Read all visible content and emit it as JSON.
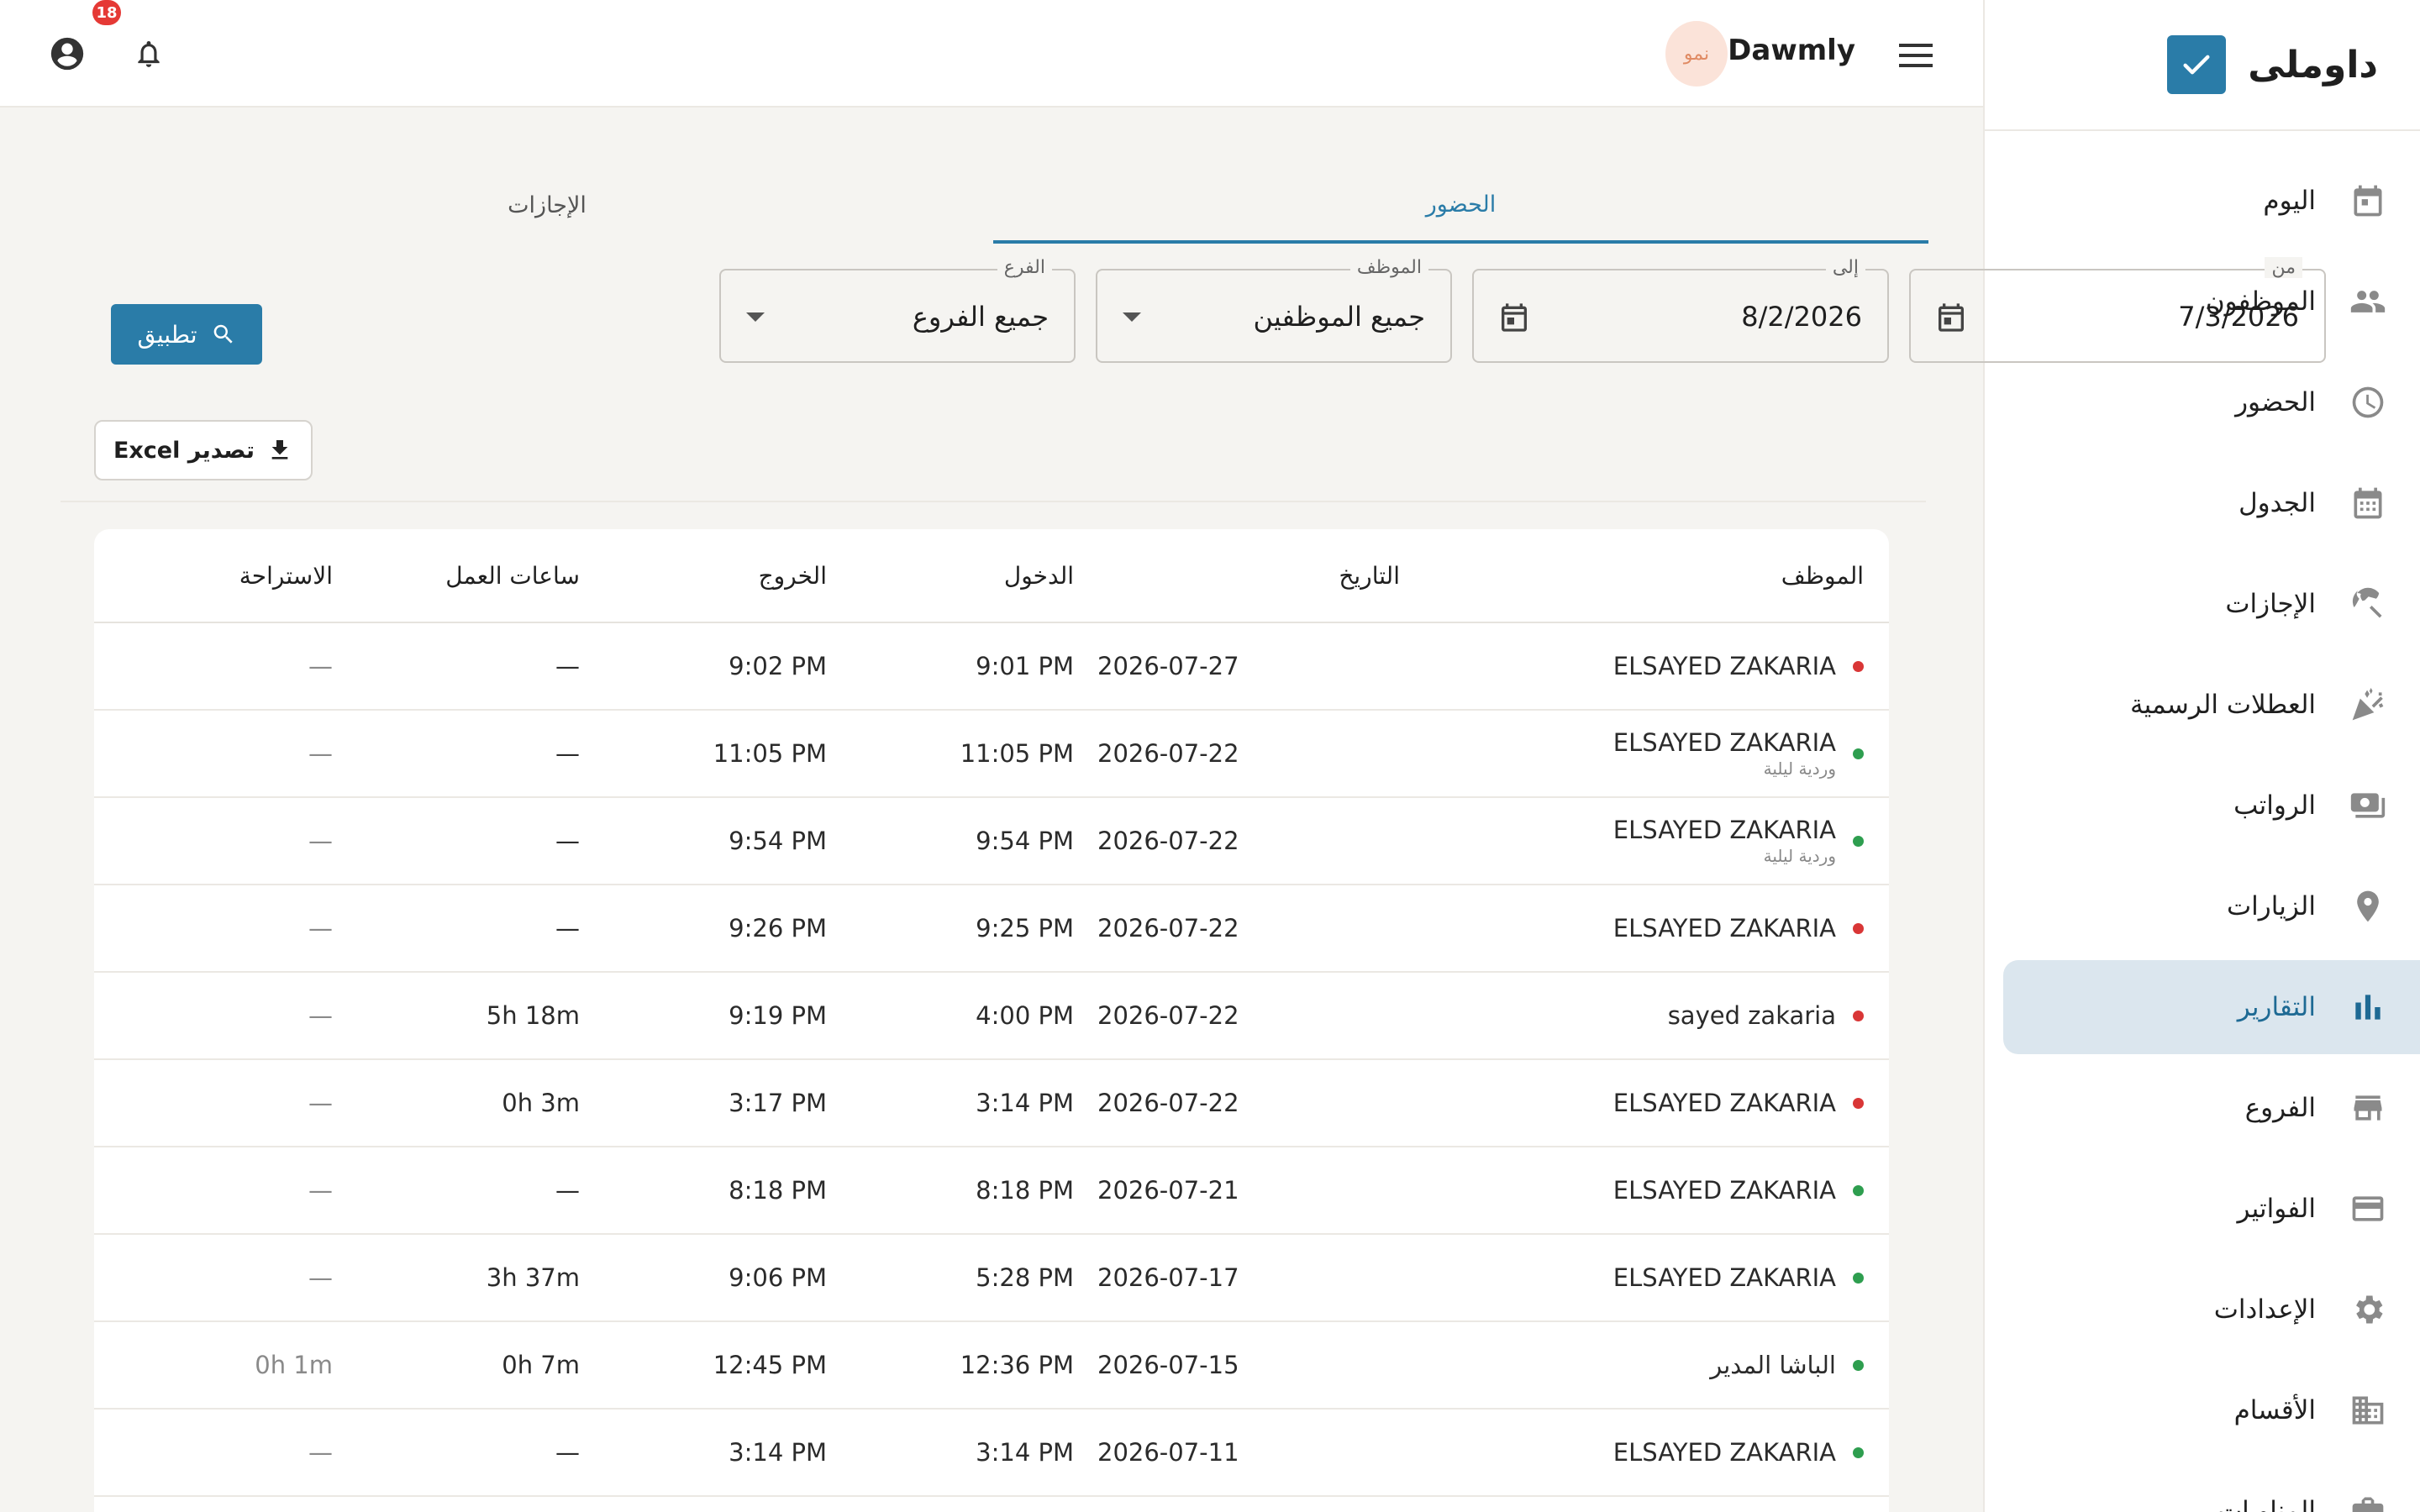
{
  "brand": {
    "name": "داوملى",
    "logo_color": "#2a7ca8"
  },
  "sidebar": {
    "items": [
      {
        "label": "اليوم",
        "icon": "calendar-today-icon"
      },
      {
        "label": "الموظفون",
        "icon": "people-icon"
      },
      {
        "label": "الحضور",
        "icon": "clock-icon"
      },
      {
        "label": "الجدول",
        "icon": "calendar-grid-icon"
      },
      {
        "label": "الإجازات",
        "icon": "beach-umbrella-icon"
      },
      {
        "label": "العطلات الرسمية",
        "icon": "celebration-icon"
      },
      {
        "label": "الرواتب",
        "icon": "payments-icon"
      },
      {
        "label": "الزيارات",
        "icon": "location-pin-icon"
      },
      {
        "label": "التقارير",
        "icon": "bar-chart-icon",
        "active": true
      },
      {
        "label": "الفروع",
        "icon": "store-icon"
      },
      {
        "label": "الفواتير",
        "icon": "credit-card-icon"
      },
      {
        "label": "الإعدادات",
        "icon": "gear-icon"
      },
      {
        "label": "الأقسام",
        "icon": "building-icon"
      },
      {
        "label": "المناوبات",
        "icon": "briefcase-icon"
      }
    ]
  },
  "topbar": {
    "company_name": "Dawmly",
    "company_avatar_text": "نمو",
    "notification_count": "18"
  },
  "tabs": {
    "attendance": "الحضور",
    "leaves": "الإجازات"
  },
  "filters": {
    "from_label": "من",
    "from_value": "7/3/2026",
    "to_label": "إلى",
    "to_value": "8/2/2026",
    "employee_label": "الموظف",
    "employee_value": "جميع الموظفين",
    "branch_label": "الفرع",
    "branch_value": "جميع الفروع",
    "apply_label": "تطبيق"
  },
  "export": {
    "label": "تصدير Excel"
  },
  "table": {
    "columns": {
      "employee": "الموظف",
      "date": "التاريخ",
      "check_in": "الدخول",
      "check_out": "الخروج",
      "work_hours": "ساعات العمل",
      "break": "الاستراحة"
    },
    "rows": [
      {
        "employee": "ELSAYED ZAKARIA",
        "sub": "",
        "status": "red",
        "date": "2026-07-27",
        "in": "9:01 PM",
        "out": "9:02 PM",
        "hours": "—",
        "break": "—"
      },
      {
        "employee": "ELSAYED ZAKARIA",
        "sub": "وردية ليلية",
        "status": "green",
        "date": "2026-07-22",
        "in": "11:05 PM",
        "out": "11:05 PM",
        "hours": "—",
        "break": "—"
      },
      {
        "employee": "ELSAYED ZAKARIA",
        "sub": "وردية ليلية",
        "status": "green",
        "date": "2026-07-22",
        "in": "9:54 PM",
        "out": "9:54 PM",
        "hours": "—",
        "break": "—"
      },
      {
        "employee": "ELSAYED ZAKARIA",
        "sub": "",
        "status": "red",
        "date": "2026-07-22",
        "in": "9:25 PM",
        "out": "9:26 PM",
        "hours": "—",
        "break": "—"
      },
      {
        "employee": "sayed zakaria",
        "sub": "",
        "status": "red",
        "date": "2026-07-22",
        "in": "4:00 PM",
        "out": "9:19 PM",
        "hours": "5h 18m",
        "break": "—"
      },
      {
        "employee": "ELSAYED ZAKARIA",
        "sub": "",
        "status": "red",
        "date": "2026-07-22",
        "in": "3:14 PM",
        "out": "3:17 PM",
        "hours": "0h 3m",
        "break": "—"
      },
      {
        "employee": "ELSAYED ZAKARIA",
        "sub": "",
        "status": "green",
        "date": "2026-07-21",
        "in": "8:18 PM",
        "out": "8:18 PM",
        "hours": "—",
        "break": "—"
      },
      {
        "employee": "ELSAYED ZAKARIA",
        "sub": "",
        "status": "green",
        "date": "2026-07-17",
        "in": "5:28 PM",
        "out": "9:06 PM",
        "hours": "3h 37m",
        "break": "—"
      },
      {
        "employee": "الباشا المدير",
        "sub": "",
        "status": "green",
        "date": "2026-07-15",
        "in": "12:36 PM",
        "out": "12:45 PM",
        "hours": "0h 7m",
        "break": "0h 1m"
      },
      {
        "employee": "ELSAYED ZAKARIA",
        "sub": "",
        "status": "green",
        "date": "2026-07-11",
        "in": "3:14 PM",
        "out": "3:14 PM",
        "hours": "—",
        "break": "—"
      }
    ]
  },
  "colors": {
    "accent": "#2a7ca8",
    "status_green": "#2e9e4f",
    "status_red": "#d93636",
    "active_bg": "#dbe6ee"
  }
}
